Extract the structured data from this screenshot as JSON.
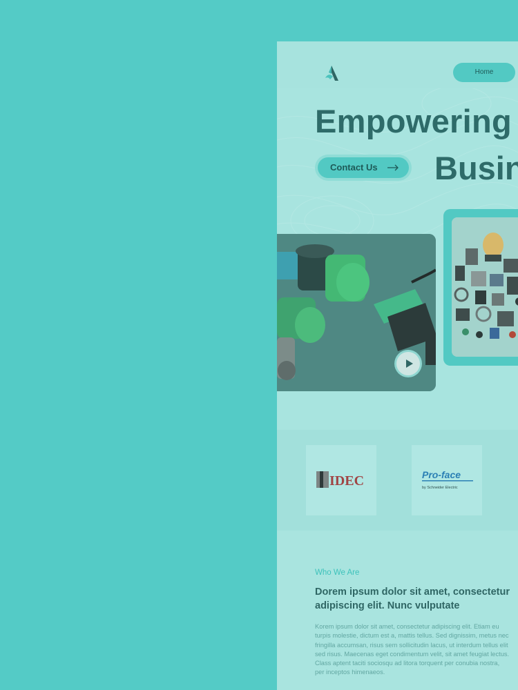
{
  "nav": {
    "home_label": "Home"
  },
  "hero": {
    "line1": "Empowering",
    "line2": "Busin",
    "contact_label": "Contact Us"
  },
  "brands": [
    {
      "name": "IDEC"
    },
    {
      "name": "Pro-face",
      "sub": "by Schneider Electric"
    }
  ],
  "about": {
    "eyebrow": "Who We Are",
    "title": "Dorem ipsum dolor sit amet, consectetur adipiscing elit. Nunc vulputate",
    "body": "Korem ipsum dolor sit amet, consectetur adipiscing elit. Etiam eu turpis molestie, dictum est a, mattis tellus. Sed dignissim, metus nec fringilla accumsan, risus sem sollicitudin lacus, ut interdum tellus elit sed risus. Maecenas eget condimentum velit, sit amet feugiat lectus. Class aptent taciti sociosqu ad litora torquent per conubia nostra, per inceptos himenaeos."
  },
  "colors": {
    "outer_bg": "#54cbc6",
    "page_bg": "#a8e4df",
    "accent": "#52c9c3",
    "heading": "#2e6b69"
  },
  "icons": [
    "logo-mark-icon",
    "arrow-right-icon",
    "play-icon"
  ]
}
